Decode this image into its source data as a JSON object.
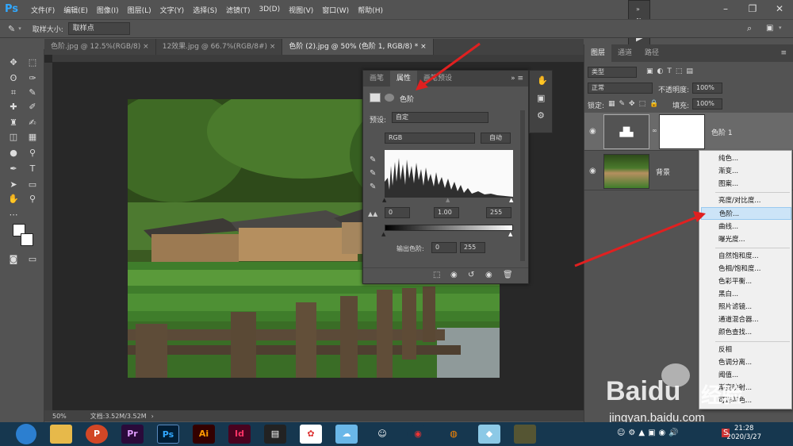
{
  "app": {
    "logo": "Ps"
  },
  "menu": [
    "文件(F)",
    "编辑(E)",
    "图像(I)",
    "图层(L)",
    "文字(Y)",
    "选择(S)",
    "滤镜(T)",
    "3D(D)",
    "视图(V)",
    "窗口(W)",
    "帮助(H)"
  ],
  "options": {
    "sample_label": "取样大小:",
    "sample_value": "取样点"
  },
  "tabs": [
    {
      "label": "色阶.jpg @ 12.5%(RGB/8)"
    },
    {
      "label": "12效果.jpg @ 66.7%(RGB/8#)"
    },
    {
      "label": "色阶 (2).jpg @ 50% (色阶 1, RGB/8) *"
    }
  ],
  "status": {
    "zoom": "50%",
    "doc": "文档:3.52M/3.52M"
  },
  "properties": {
    "tabs": [
      "画笔",
      "属性",
      "画笔预设"
    ],
    "title": "色阶",
    "preset_label": "预设:",
    "preset_value": "自定",
    "channel": "RGB",
    "auto": "自动",
    "input_black": "0",
    "input_gamma": "1.00",
    "input_white": "255",
    "output_label": "输出色阶:",
    "output_black": "0",
    "output_white": "255"
  },
  "layers": {
    "tabs": [
      "图层",
      "通道",
      "路径"
    ],
    "kind": "类型",
    "blend": "正常",
    "opacity_label": "不透明度:",
    "opacity": "100%",
    "lock_label": "锁定:",
    "fill_label": "填充:",
    "fill": "100%",
    "items": [
      {
        "name": "色阶 1"
      },
      {
        "name": "背景"
      }
    ]
  },
  "context_menu": {
    "groups": [
      [
        "纯色...",
        "渐变...",
        "图案..."
      ],
      [
        "亮度/对比度...",
        "色阶...",
        "曲线...",
        "曝光度..."
      ],
      [
        "自然饱和度...",
        "色相/饱和度...",
        "色彩平衡...",
        "黑白...",
        "照片滤镜...",
        "通道混合器...",
        "颜色查找..."
      ],
      [
        "反相",
        "色调分离...",
        "阈值...",
        "渐变映射...",
        "可选颜色..."
      ]
    ],
    "highlighted": "色阶..."
  },
  "taskbar": {
    "apps": [
      "P",
      "Pr",
      "Ps",
      "Ai",
      "Id"
    ],
    "time": "21:28",
    "date": "2020/3/27"
  },
  "watermark": {
    "brand": "Baidu",
    "sub": "经验",
    "url": "jingyan.baidu.com"
  },
  "colors": {
    "ps_blue": "#31a8ff",
    "highlight": "#cce4f7",
    "arrow": "#e02020",
    "taskbar": "#16374f"
  }
}
